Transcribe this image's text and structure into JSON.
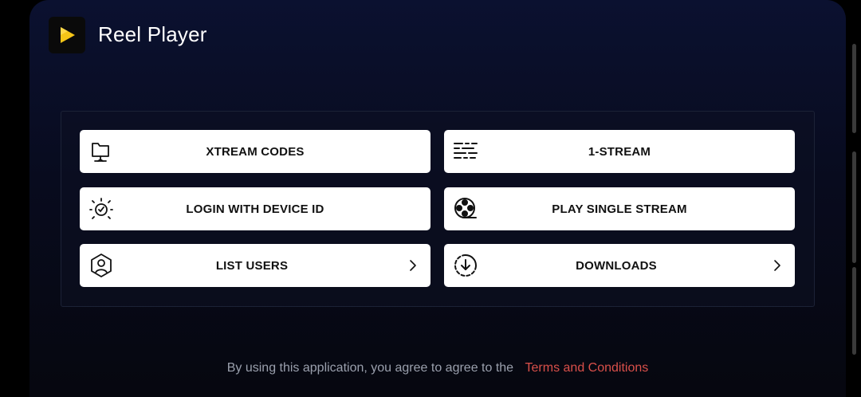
{
  "app": {
    "title": "Reel Player",
    "logo_icon": "play-logo-icon",
    "accent": "#f5c518"
  },
  "menu": {
    "items": [
      {
        "label": "XTREAM CODES",
        "icon": "folder-network-icon",
        "has_chevron": false
      },
      {
        "label": "1-STREAM",
        "icon": "stream-lines-icon",
        "has_chevron": false
      },
      {
        "label": "LOGIN WITH DEVICE ID",
        "icon": "device-sun-icon",
        "has_chevron": false
      },
      {
        "label": "PLAY SINGLE STREAM",
        "icon": "film-reel-icon",
        "has_chevron": false
      },
      {
        "label": "LIST USERS",
        "icon": "user-hexagon-icon",
        "has_chevron": true
      },
      {
        "label": "DOWNLOADS",
        "icon": "download-circle-icon",
        "has_chevron": true
      }
    ]
  },
  "footer": {
    "text": "By using this application, you agree to agree to the",
    "link": "Terms and Conditions",
    "link_color": "#d9504a"
  }
}
